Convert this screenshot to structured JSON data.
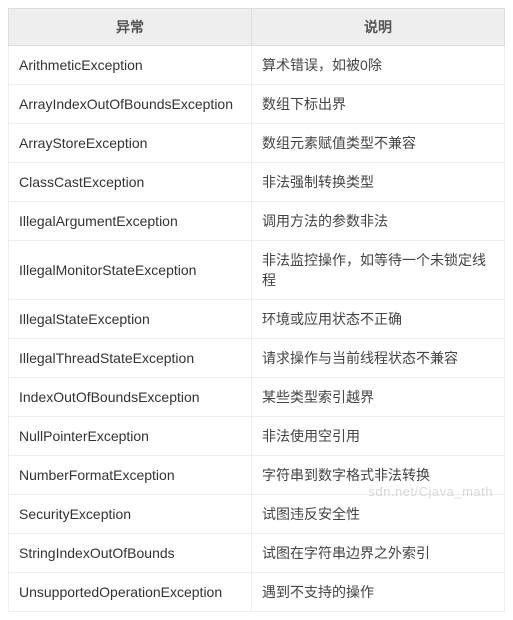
{
  "table": {
    "headers": [
      "异常",
      "说明"
    ],
    "rows": [
      {
        "name": "ArithmeticException",
        "desc": "算术错误，如被0除"
      },
      {
        "name": "ArrayIndexOutOfBoundsException",
        "desc": "数组下标出界"
      },
      {
        "name": "ArrayStoreException",
        "desc": "数组元素赋值类型不兼容"
      },
      {
        "name": "ClassCastException",
        "desc": "非法强制转换类型"
      },
      {
        "name": "IllegalArgumentException",
        "desc": "调用方法的参数非法"
      },
      {
        "name": "IllegalMonitorStateException",
        "desc": "非法监控操作，如等待一个未锁定线程"
      },
      {
        "name": "IllegalStateException",
        "desc": "环境或应用状态不正确"
      },
      {
        "name": "IllegalThreadStateException",
        "desc": "请求操作与当前线程状态不兼容"
      },
      {
        "name": "IndexOutOfBoundsException",
        "desc": "某些类型索引越界"
      },
      {
        "name": "NullPointerException",
        "desc": "非法使用空引用"
      },
      {
        "name": "NumberFormatException",
        "desc": "字符串到数字格式非法转换"
      },
      {
        "name": "SecurityException",
        "desc": "试图违反安全性"
      },
      {
        "name": "StringIndexOutOfBounds",
        "desc": "试图在字符串边界之外索引"
      },
      {
        "name": "UnsupportedOperationException",
        "desc": "遇到不支持的操作"
      }
    ]
  },
  "watermark": "sdn.net/Cjava_math"
}
